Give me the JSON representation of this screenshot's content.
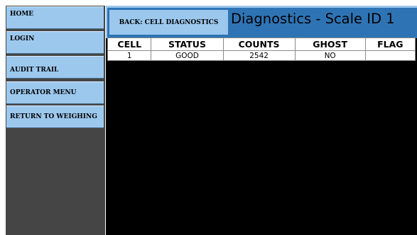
{
  "sidebar": {
    "items": [
      {
        "label": "HOME"
      },
      {
        "label": "LOGIN"
      },
      {
        "label": "AUDIT TRAIL"
      },
      {
        "label": "OPERATOR MENU"
      },
      {
        "label": "RETURN TO WEIGHING"
      }
    ]
  },
  "header": {
    "back_label": "BACK: CELL DIAGNOSTICS",
    "title": "Diagnostics - Scale ID 1"
  },
  "table": {
    "columns": [
      "CELL",
      "STATUS",
      "COUNTS",
      "GHOST",
      "FLAG"
    ],
    "rows": [
      {
        "cell": "1",
        "status": "GOOD",
        "counts": "2542",
        "ghost": "NO",
        "flag": ""
      }
    ]
  },
  "colors": {
    "button_blue": "#9cc8ee",
    "header_blue": "#2e74b5",
    "sidebar_bg": "#454545",
    "main_bg": "#000000"
  }
}
